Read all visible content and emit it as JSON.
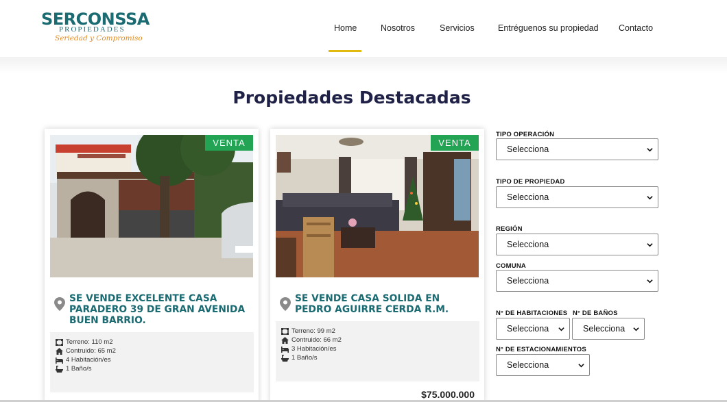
{
  "logo": {
    "name": "SERCONSSA",
    "sub": "PROPIEDADES",
    "tagline": "Seriedad y Compromiso"
  },
  "nav": {
    "items": [
      {
        "label": "Home",
        "active": true
      },
      {
        "label": "Nosotros",
        "active": false
      },
      {
        "label": "Servicios",
        "active": false
      },
      {
        "label": "Entréguenos su propiedad",
        "active": false
      },
      {
        "label": "Contacto",
        "active": false
      }
    ],
    "accent_color": "#e1b90f"
  },
  "page": {
    "title": "Propiedades Destacadas"
  },
  "properties": [
    {
      "badge": "VENTA",
      "title": "SE VENDE EXCELENTE CASA PARADERO 39 DE GRAN AVENIDA BUEN BARRIO.",
      "specs": {
        "terreno": "Terreno: 110 m2",
        "construido": "Contruido: 65 m2",
        "habitaciones": "4 Habitación/es",
        "banos": "1 Baño/s"
      },
      "price": ""
    },
    {
      "badge": "VENTA",
      "title": "SE VENDE CASA SOLIDA EN PEDRO AGUIRRE CERDA R.M.",
      "specs": {
        "terreno": "Terreno: 99 m2",
        "construido": "Contruido: 66 m2",
        "habitaciones": "3 Habitación/es",
        "banos": "1 Baño/s"
      },
      "price": "$75.000.000"
    }
  ],
  "filters": {
    "tipo_operacion": {
      "label": "TIPO OPERACIÓN",
      "value": "Selecciona"
    },
    "tipo_propiedad": {
      "label": "TIPO DE PROPIEDAD",
      "value": "Selecciona"
    },
    "region": {
      "label": "REGIÓN",
      "value": "Selecciona"
    },
    "comuna": {
      "label": "COMUNA",
      "value": "Selecciona"
    },
    "habitaciones": {
      "label": "N° DE HABITACIONES",
      "value": "Selecciona"
    },
    "banos": {
      "label": "N° DE BAÑOS",
      "value": "Selecciona"
    },
    "estacionamientos": {
      "label": "N° DE ESTACIONAMIENTOS",
      "value": "Selecciona"
    }
  },
  "colors": {
    "brand_teal": "#1b6b73",
    "title_navy": "#1f2147",
    "badge_green": "#23a455",
    "tagline_orange": "#e38b1d"
  }
}
